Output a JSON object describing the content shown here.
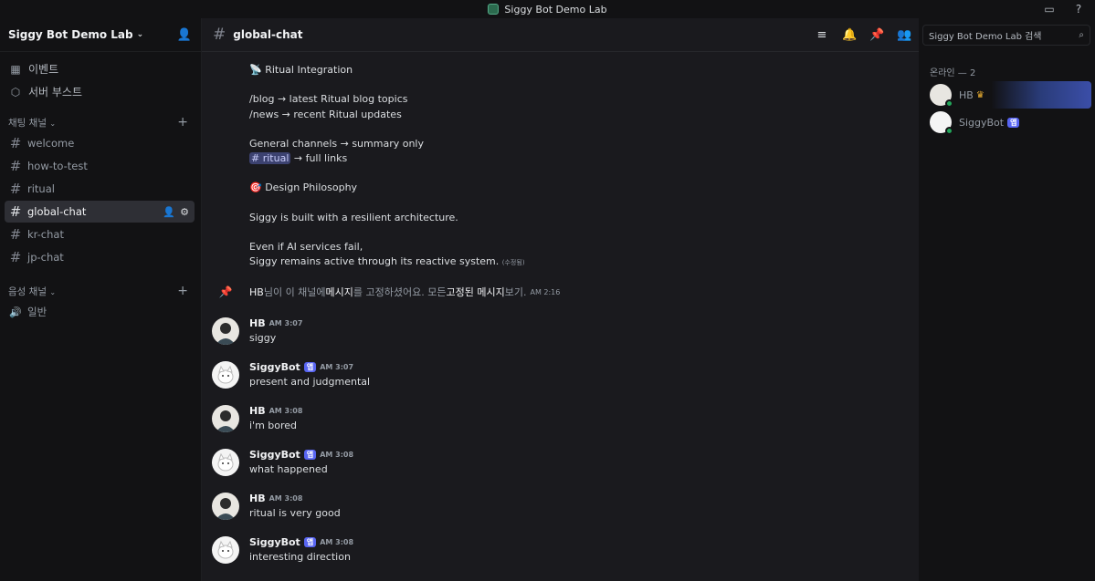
{
  "window": {
    "title": "Siggy Bot Demo Lab"
  },
  "sidebar": {
    "server_name": "Siggy Bot Demo Lab",
    "top_items": [
      {
        "label": "이벤트",
        "icon": "calendar-icon"
      },
      {
        "label": "서버 부스트",
        "icon": "boost-icon"
      }
    ],
    "text_category": "채팅 채널",
    "text_channels": [
      "welcome",
      "how-to-test",
      "ritual",
      "global-chat",
      "kr-chat",
      "jp-chat"
    ],
    "active_channel": "global-chat",
    "voice_category": "음성 채널",
    "voice_channels": [
      "일반"
    ]
  },
  "header": {
    "channel": "global-chat",
    "search_placeholder": "Siggy Bot Demo Lab 검색"
  },
  "messages": {
    "bot_body": {
      "l1": "Ritual Integration",
      "l2": "/blog → latest Ritual blog topics",
      "l3": "/news → recent Ritual updates",
      "l4": "General channels → summary only",
      "l5_mention": "# ritual",
      "l5_rest": " → full links",
      "l6": "Design Philosophy",
      "l7": "Siggy is built with a resilient architecture.",
      "l8": "Even if AI services fail,",
      "l9": "Siggy remains active through its reactive system.",
      "edited": "(수정됨)"
    },
    "pin_notice": {
      "user": "HB",
      "part1": " 님이 이 채널에 ",
      "msg": "메시지",
      "part2": "를 고정하셨어요. 모든 ",
      "pinned": "고정된 메시지",
      "part3": " 보기.",
      "time": "AM 2:16"
    },
    "list": [
      {
        "author": "HB",
        "time": "AM 3:07",
        "text": "siggy",
        "bot": false
      },
      {
        "author": "SiggyBot",
        "time": "AM 3:07",
        "text": "present and judgmental",
        "bot": true
      },
      {
        "author": "HB",
        "time": "AM 3:08",
        "text": "i'm bored",
        "bot": false
      },
      {
        "author": "SiggyBot",
        "time": "AM 3:08",
        "text": "what happened",
        "bot": true
      },
      {
        "author": "HB",
        "time": "AM 3:08",
        "text": "ritual is very good",
        "bot": false
      },
      {
        "author": "SiggyBot",
        "time": "AM 3:08",
        "text": "interesting direction",
        "bot": true
      }
    ],
    "app_tag": "앱"
  },
  "members": {
    "category": "온라인 — 2",
    "list": [
      {
        "name": "HB"
      },
      {
        "name": "SiggyBot"
      }
    ]
  },
  "colors": {
    "accent": "#5865f2",
    "online": "#23a55a"
  }
}
